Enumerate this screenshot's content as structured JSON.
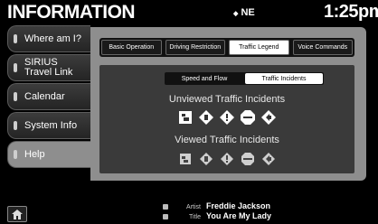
{
  "header": {
    "title": "INFORMATION",
    "compass": "NE",
    "time": "1:25pm"
  },
  "sidebar": {
    "items": [
      {
        "label": "Where am I?",
        "active": false
      },
      {
        "label": "SIRIUS Travel Link",
        "active": false
      },
      {
        "label": "Calendar",
        "active": false
      },
      {
        "label": "System Info",
        "active": false
      },
      {
        "label": "Help",
        "active": true
      }
    ]
  },
  "tabs": [
    {
      "label": "Basic Operation",
      "active": false
    },
    {
      "label": "Driving Restriction",
      "active": false
    },
    {
      "label": "Traffic Legend",
      "active": true
    },
    {
      "label": "Voice Commands",
      "active": false
    }
  ],
  "subtabs": [
    {
      "label": "Speed and Flow",
      "active": false
    },
    {
      "label": "Traffic Incidents",
      "active": true
    }
  ],
  "sections": {
    "unviewed": {
      "title": "Unviewed Traffic Incidents"
    },
    "viewed": {
      "title": "Viewed Traffic Incidents"
    }
  },
  "incident_icons": [
    "traffic-jam-icon",
    "road-work-icon",
    "warning-icon",
    "road-closed-icon",
    "incident-arrow-icon"
  ],
  "now_playing": {
    "artist_key": "Artist",
    "artist": "Freddie Jackson",
    "title_key": "Title",
    "title": "You Are My Lady"
  },
  "colors": {
    "panel": "#8e8e8e",
    "inner": "#3a3a3a",
    "unviewed_icon": "#ffffff",
    "viewed_icon": "#cfcfcf"
  }
}
